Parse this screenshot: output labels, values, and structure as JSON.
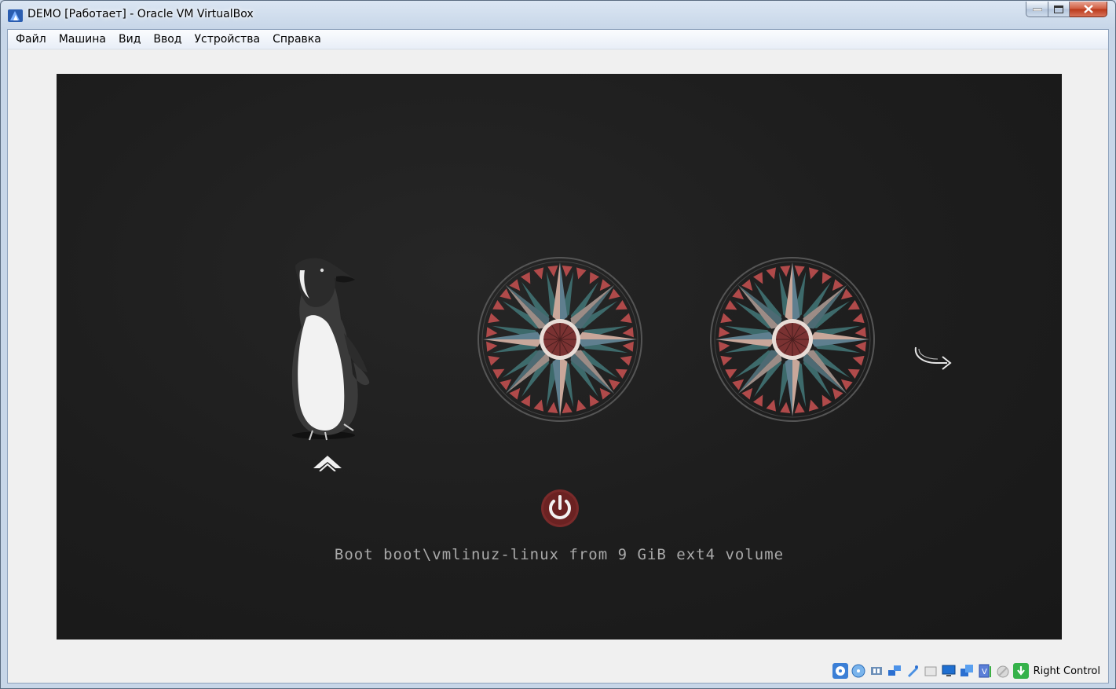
{
  "window": {
    "title": "DEMO [Работает] - Oracle VM VirtualBox"
  },
  "menubar": {
    "items": [
      "Файл",
      "Машина",
      "Вид",
      "Ввод",
      "Устройства",
      "Справка"
    ]
  },
  "boot_screen": {
    "boot_text": "Boot boot\\vmlinuz-linux from 9 GiB ext4 volume",
    "entries": [
      {
        "icon": "penguin-icon",
        "selected": true
      },
      {
        "icon": "compass-icon",
        "selected": false
      },
      {
        "icon": "compass-icon",
        "selected": false
      }
    ],
    "colors": {
      "background": "#1c1c1c",
      "power_red": "#7a2a2a",
      "compass_teal": "#3d6a6b",
      "compass_rose": "#b04a4a",
      "compass_cream": "#c9a79a"
    }
  },
  "statusbar": {
    "icons": [
      "hard-disk-icon",
      "optical-disk-icon",
      "audio-icon",
      "network-icon",
      "usb-icon",
      "shared-folders-icon",
      "display-icon",
      "video-capture-icon",
      "virtualization-icon",
      "mouse-integration-icon",
      "keyboard-capture-icon"
    ],
    "host_key": "Right Control"
  }
}
